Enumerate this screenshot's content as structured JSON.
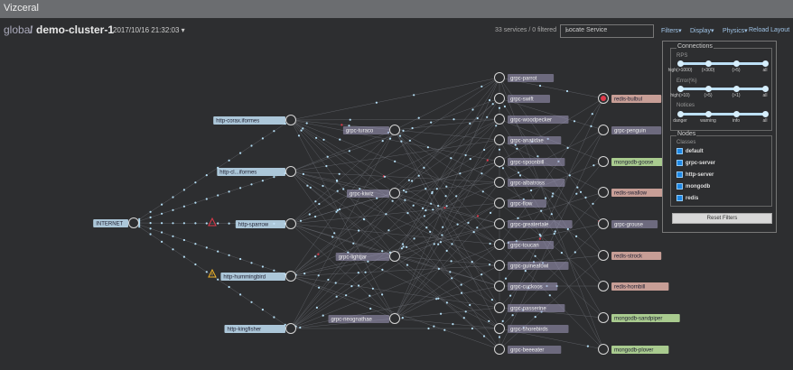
{
  "app": {
    "title": "Vizceral"
  },
  "header": {
    "breadcrumb_global": "global",
    "breadcrumb_separator": "/",
    "cluster": "demo-cluster-1",
    "datetime": "2017/10/16 21:32:03",
    "services_count": "33 services / 0 filtered",
    "locate_placeholder": "Locate Service",
    "menu_filters": "Filters",
    "menu_display": "Display",
    "menu_physics": "Physics",
    "reload": "Reload Layout"
  },
  "colors": {
    "background": "#2d2e30",
    "edge": "#6d7178",
    "particle": "#b5dff6",
    "particle_error": "#e0394a",
    "node_ring": "#d6d6d6",
    "label_http": "#c3e2f7",
    "label_grpc": "#a39cc0",
    "label_mongodb": "#bfe6a0",
    "label_redis": "#e3b2a8",
    "warning": "#f0b429",
    "danger": "#e0394a"
  },
  "graph": {
    "nodes": [
      {
        "id": "internet",
        "label": "INTERNET",
        "kind": "http"
      },
      {
        "id": "ccr",
        "label": "http-corax.iformes",
        "kind": "http"
      },
      {
        "id": "cli",
        "label": "http-cl...iformes",
        "kind": "http"
      },
      {
        "id": "spa",
        "label": "http-sparrow",
        "kind": "http"
      },
      {
        "id": "hum",
        "label": "http-hummingbird",
        "kind": "http"
      },
      {
        "id": "kin",
        "label": "http-kingfisher",
        "kind": "http"
      },
      {
        "id": "tur",
        "label": "grpc-turaco",
        "kind": "grpc"
      },
      {
        "id": "kea",
        "label": "grpc-kiwiz",
        "kind": "grpc"
      },
      {
        "id": "lig",
        "label": "grpc-lightjar",
        "kind": "grpc"
      },
      {
        "id": "neo",
        "label": "grpc-neognathae",
        "kind": "grpc"
      },
      {
        "id": "par",
        "label": "grpc-parrot",
        "kind": "grpc"
      },
      {
        "id": "swi",
        "label": "grpc-swift",
        "kind": "grpc"
      },
      {
        "id": "woo",
        "label": "grpc-woodpecker",
        "kind": "grpc"
      },
      {
        "id": "ana",
        "label": "grpc-anatidae",
        "kind": "grpc"
      },
      {
        "id": "spo",
        "label": "grpc-spoonbill",
        "kind": "grpc"
      },
      {
        "id": "alb",
        "label": "grpc-albatross",
        "kind": "grpc"
      },
      {
        "id": "flo",
        "label": "grpc-flow",
        "kind": "grpc"
      },
      {
        "id": "gre",
        "label": "grpc-greatertale",
        "kind": "grpc"
      },
      {
        "id": "tou",
        "label": "grpc-toucan",
        "kind": "grpc"
      },
      {
        "id": "gui",
        "label": "grpc-guineafowl",
        "kind": "grpc"
      },
      {
        "id": "cuc",
        "label": "grpc-cuckoos",
        "kind": "grpc"
      },
      {
        "id": "pas",
        "label": "grpc-passerine",
        "kind": "grpc"
      },
      {
        "id": "sho",
        "label": "grpc-shorebirds",
        "kind": "grpc"
      },
      {
        "id": "bee",
        "label": "grpc-beeeater",
        "kind": "grpc"
      },
      {
        "id": "rbu",
        "label": "redis-bulbul",
        "kind": "redis",
        "alert": true
      },
      {
        "id": "pen",
        "label": "grpc-penguin",
        "kind": "grpc"
      },
      {
        "id": "mgo",
        "label": "mongodb-goose",
        "kind": "mongodb"
      },
      {
        "id": "rsw",
        "label": "redis-swallow",
        "kind": "redis"
      },
      {
        "id": "gro",
        "label": "grpc-grouse",
        "kind": "grpc"
      },
      {
        "id": "rst",
        "label": "redis-strock",
        "kind": "redis"
      },
      {
        "id": "rhu",
        "label": "redis-hornbill",
        "kind": "redis"
      },
      {
        "id": "msa",
        "label": "mongodb-sandpiper",
        "kind": "mongodb"
      },
      {
        "id": "mpl",
        "label": "mongodb-plover",
        "kind": "mongodb"
      }
    ]
  },
  "filters": {
    "connections_title": "Connections",
    "rps_label": "RPS",
    "rps_ticks": [
      "high(>1000)",
      "(>300)",
      "(>5)",
      "all"
    ],
    "error_label": "Error(%)",
    "error_ticks": [
      "high(>10)",
      "(>5)",
      "(>1)",
      "all"
    ],
    "notices_label": "Notices",
    "notices_ticks": [
      "danger",
      "warning",
      "info",
      "all"
    ],
    "nodes_title": "Nodes",
    "classes_label": "Classes",
    "classes": [
      "default",
      "grpc-server",
      "http-server",
      "mongodb",
      "redis"
    ],
    "reset_label": "Reset Filters"
  }
}
